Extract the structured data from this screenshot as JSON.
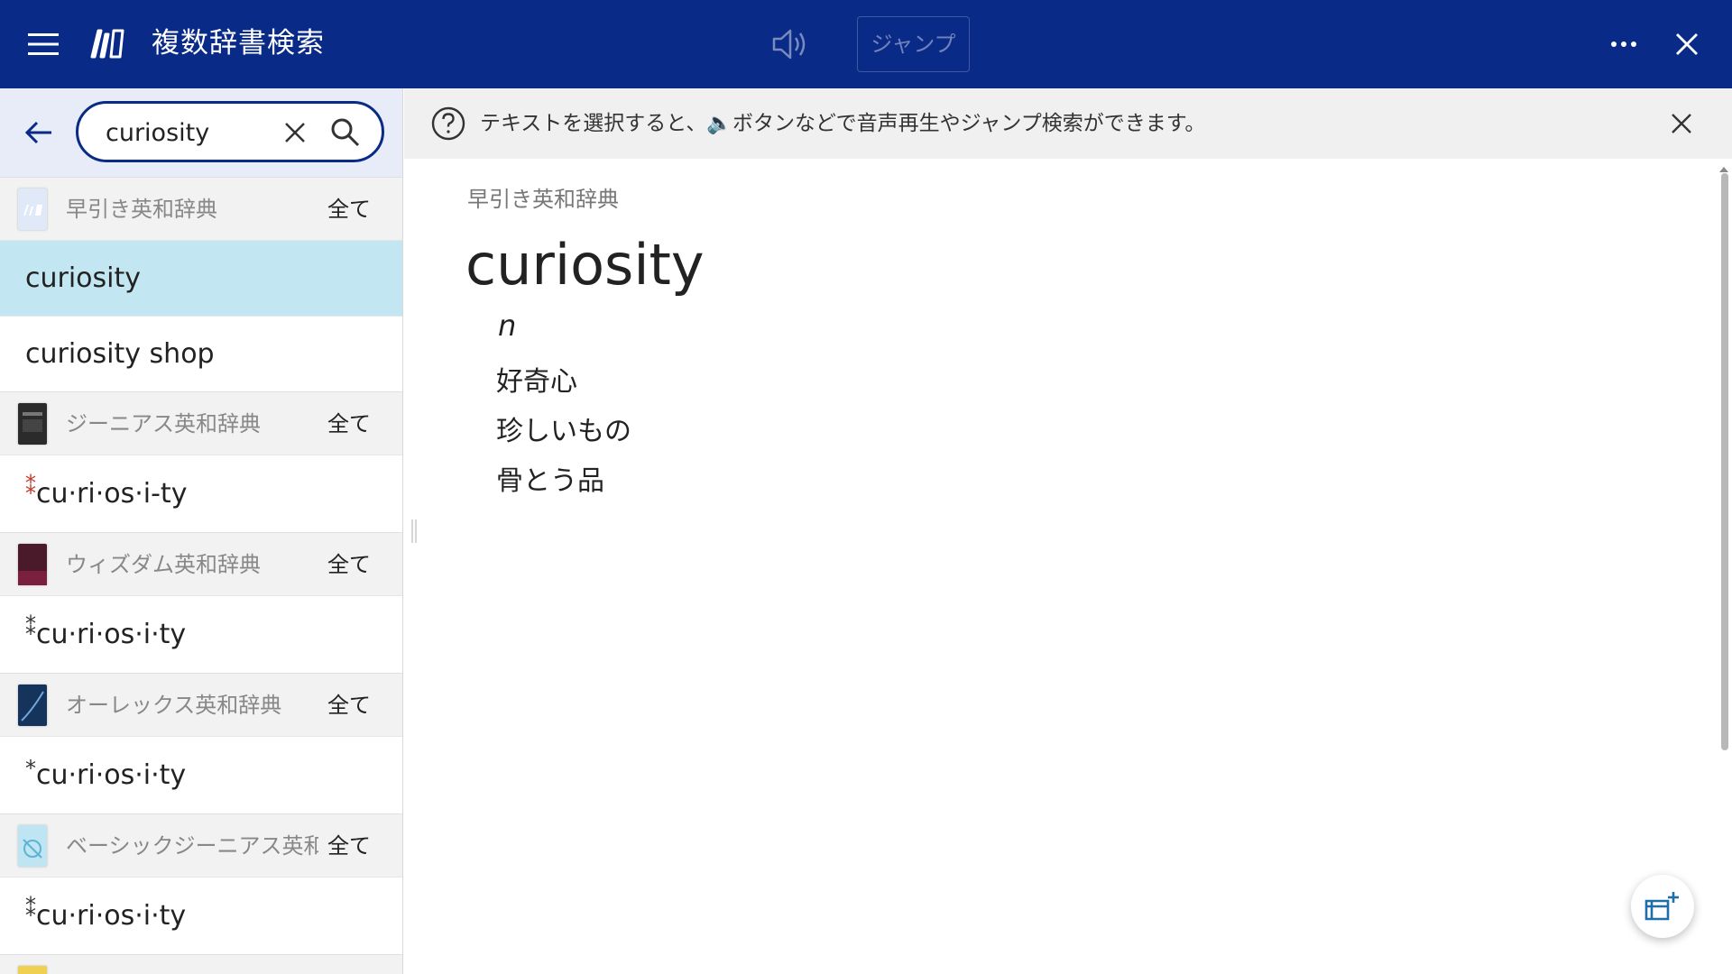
{
  "titlebar": {
    "title": "複数辞書検索",
    "jump_label": "ジャンプ",
    "icons": [
      "hamburger-menu-icon",
      "dictionary-logo-icon",
      "speaker-icon",
      "more-icon",
      "close-icon"
    ],
    "bg_color": "#0a2a88"
  },
  "search": {
    "value": "curiosity",
    "placeholder": ""
  },
  "dictionaries": [
    {
      "name": "早引き英和辞典",
      "all_label": "全て",
      "thumb_color": "#dfe9f7",
      "entries": [
        {
          "text": "curiosity",
          "mark": "",
          "selected": true
        },
        {
          "text": "curiosity shop",
          "mark": "",
          "selected": false
        }
      ]
    },
    {
      "name": "ジーニアス英和辞典",
      "all_label": "全て",
      "thumb_color": "#2b2b2b",
      "entries": [
        {
          "text": "cu·ri·os·i-ty",
          "mark": "⁑",
          "selected": false
        }
      ]
    },
    {
      "name": "ウィズダム英和辞典",
      "all_label": "全て",
      "thumb_color": "#4a1a2a",
      "entries": [
        {
          "text": "cu·ri·os·i·ty",
          "mark": "⁑",
          "selected": false
        }
      ]
    },
    {
      "name": "オーレックス英和辞典",
      "all_label": "全て",
      "thumb_color": "#16335c",
      "entries": [
        {
          "text": "cu·ri·os·i·ty",
          "mark": "*",
          "selected": false
        }
      ]
    },
    {
      "name": "ベーシックジーニアス英和辞典",
      "all_label": "全て",
      "thumb_color": "#bfe4f2",
      "entries": [
        {
          "text": "cu·ri·os·i·ty",
          "mark": "⁑",
          "selected": false
        }
      ]
    }
  ],
  "notice": {
    "text": "テキストを選択すると、🔈ボタンなどで音声再生やジャンプ検索ができます。"
  },
  "article": {
    "source": "早引き英和辞典",
    "headword": "curiosity",
    "pos": "n",
    "senses": [
      "好奇心",
      "珍しいもの",
      "骨とう品"
    ]
  }
}
